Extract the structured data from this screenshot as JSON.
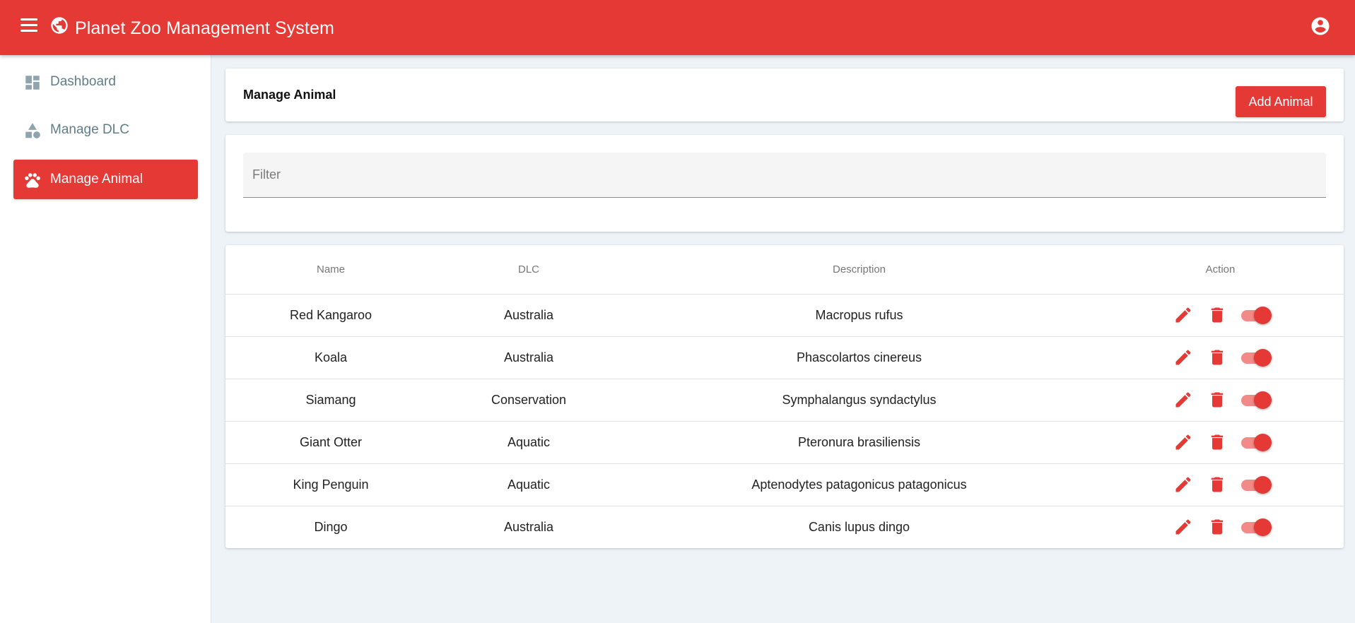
{
  "app": {
    "title": "Planet Zoo Management System",
    "brand_color": "#e53935"
  },
  "topbar": {
    "menu_icon": "menu-icon",
    "logo_icon": "globe-icon",
    "account_icon": "account-circle-icon"
  },
  "sidebar": {
    "items": [
      {
        "label": "Dashboard",
        "icon": "dashboard-icon",
        "active": false
      },
      {
        "label": "Manage DLC",
        "icon": "shapes-icon",
        "active": false
      },
      {
        "label": "Manage Animal",
        "icon": "paw-icon",
        "active": true
      }
    ]
  },
  "header": {
    "title": "Manage Animal",
    "add_button_label": "Add Animal"
  },
  "filter": {
    "placeholder": "Filter",
    "value": ""
  },
  "table": {
    "columns": [
      "Name",
      "DLC",
      "Description",
      "Action"
    ],
    "rows": [
      {
        "name": "Red Kangaroo",
        "dlc": "Australia",
        "description": "Macropus rufus",
        "enabled": true
      },
      {
        "name": "Koala",
        "dlc": "Australia",
        "description": "Phascolartos cinereus",
        "enabled": true
      },
      {
        "name": "Siamang",
        "dlc": "Conservation",
        "description": "Symphalangus syndactylus",
        "enabled": true
      },
      {
        "name": "Giant Otter",
        "dlc": "Aquatic",
        "description": "Pteronura brasiliensis",
        "enabled": true
      },
      {
        "name": "King Penguin",
        "dlc": "Aquatic",
        "description": "Aptenodytes patagonicus patagonicus",
        "enabled": true
      },
      {
        "name": "Dingo",
        "dlc": "Australia",
        "description": "Canis lupus dingo",
        "enabled": true
      }
    ],
    "action_icons": [
      "edit-icon",
      "delete-icon",
      "toggle-switch"
    ]
  }
}
